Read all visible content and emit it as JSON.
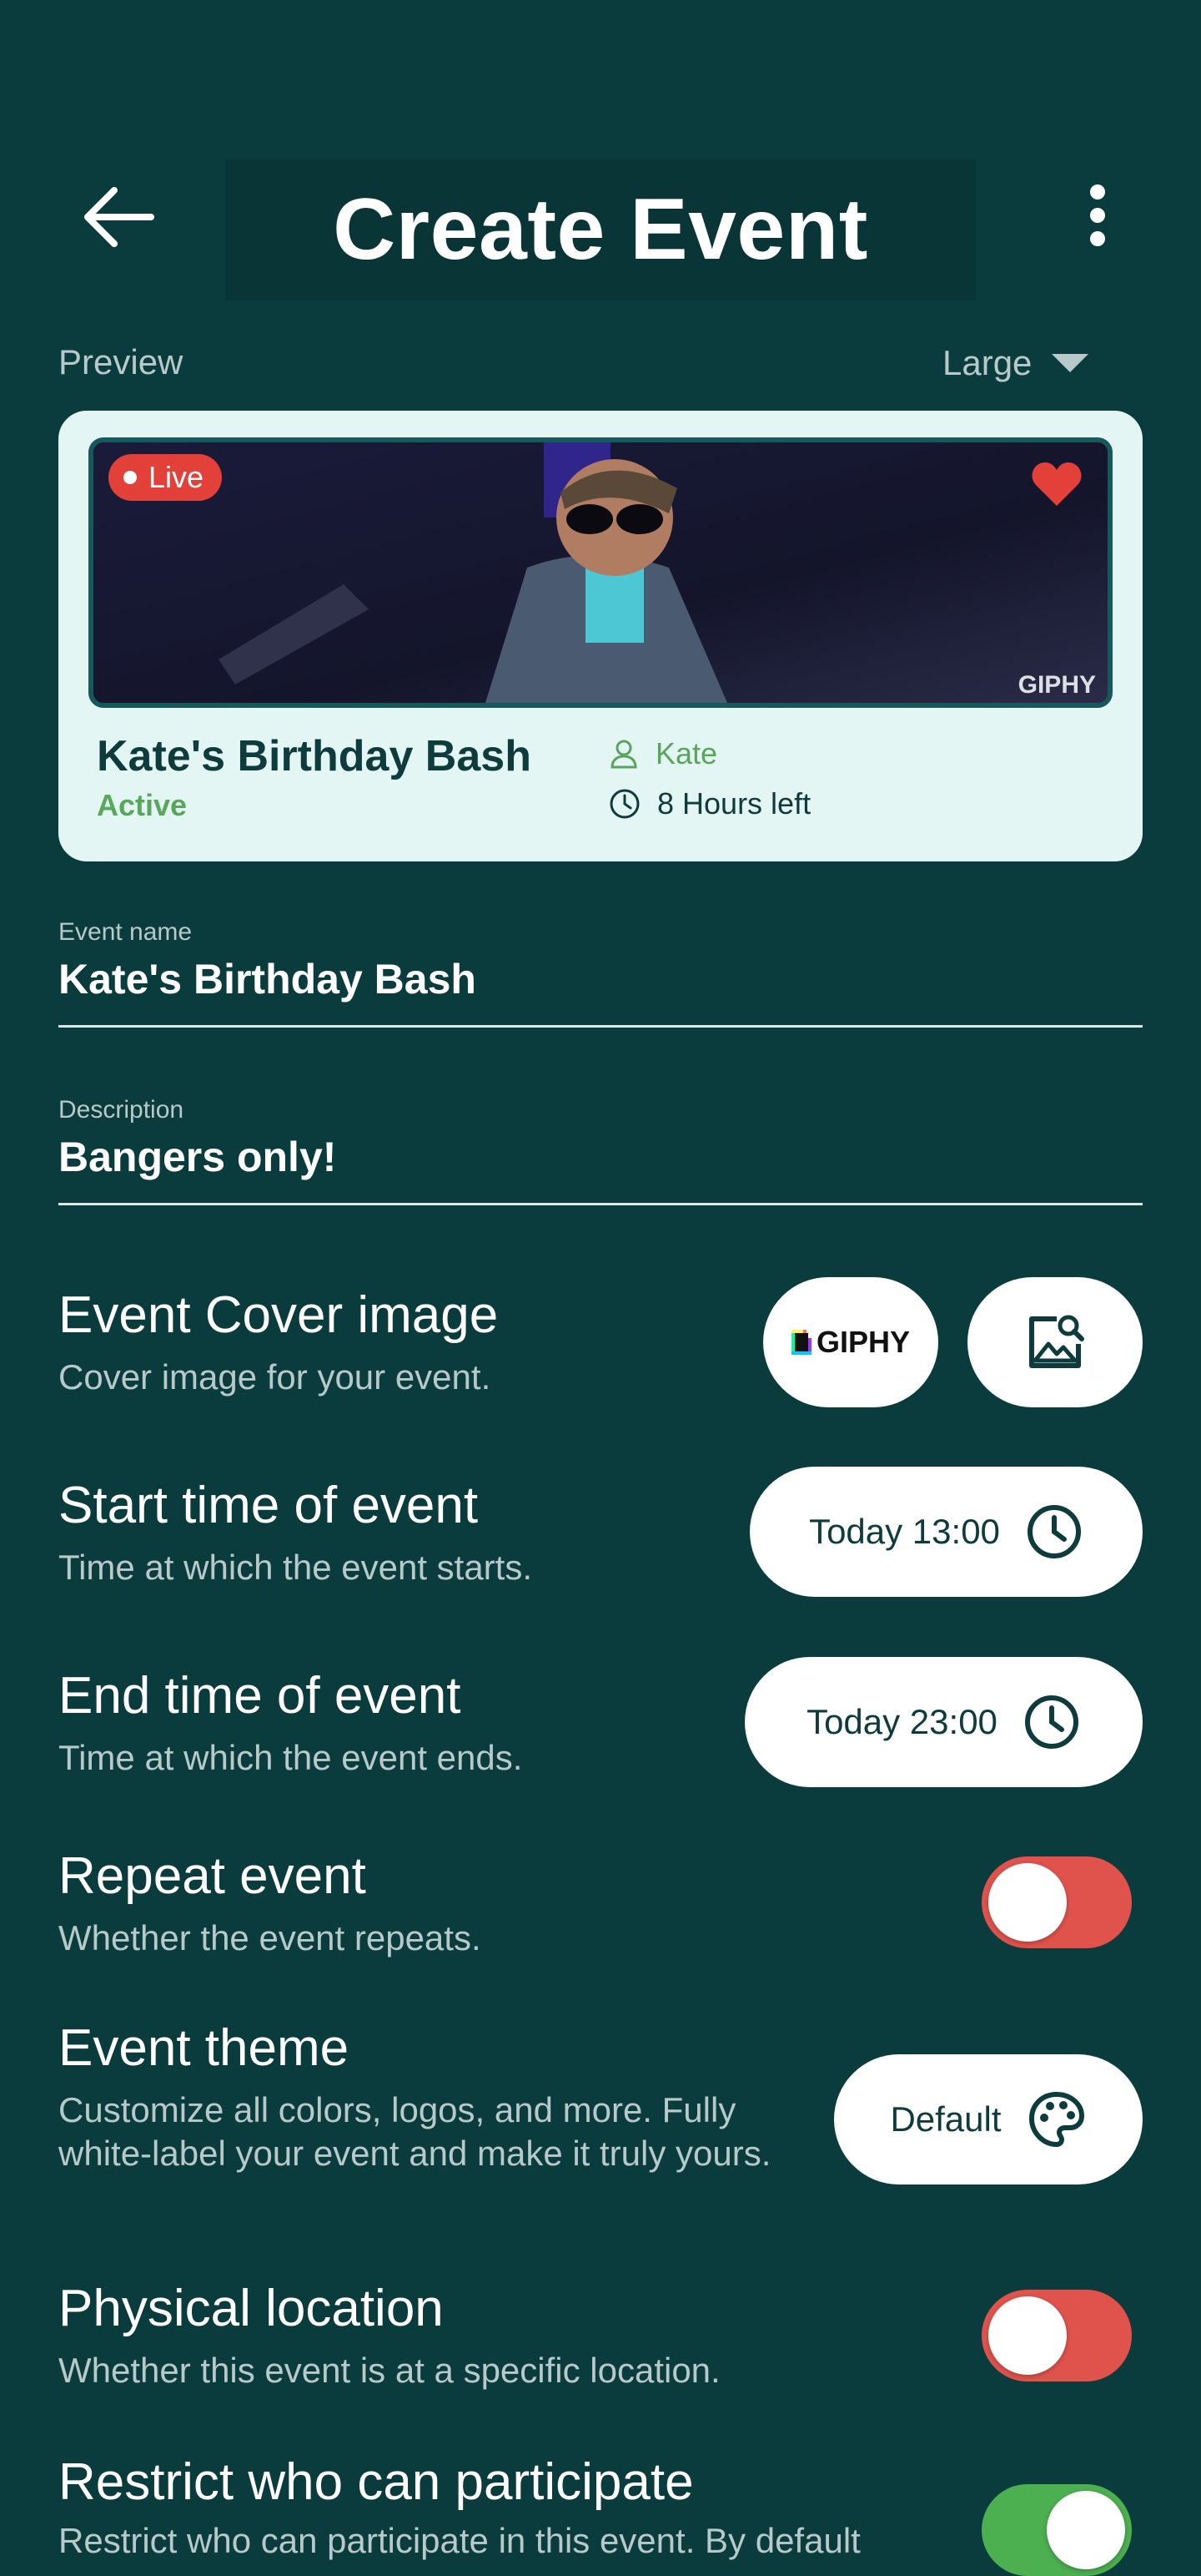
{
  "header": {
    "title": "Create Event"
  },
  "preview": {
    "label": "Preview",
    "size": "Large",
    "card": {
      "live_label": "Live",
      "event_title": "Kate's Birthday Bash",
      "status": "Active",
      "host": "Kate",
      "time_left": "8 Hours left",
      "image_watermark": "GIPHY"
    }
  },
  "fields": {
    "event_name": {
      "label": "Event name",
      "value": "Kate's Birthday Bash"
    },
    "description": {
      "label": "Description",
      "value": "Bangers only!"
    }
  },
  "settings": {
    "cover": {
      "title": "Event Cover image",
      "subtitle": "Cover image for your event.",
      "giphy_label": "GIPHY"
    },
    "start": {
      "title": "Start time of event",
      "subtitle": "Time at which the event starts.",
      "value": "Today 13:00"
    },
    "end": {
      "title": "End time of event",
      "subtitle": "Time at which the event ends.",
      "value": "Today 23:00"
    },
    "repeat": {
      "title": "Repeat event",
      "subtitle": "Whether the event repeats.",
      "enabled": false
    },
    "theme": {
      "title": "Event theme",
      "subtitle": "Customize all colors, logos, and more. Fully white-label your event and make it truly yours.",
      "value": "Default"
    },
    "location": {
      "title": "Physical location",
      "subtitle": "Whether this event is at a specific location.",
      "enabled": false
    },
    "restrict": {
      "title": "Restrict who can participate",
      "subtitle": "Restrict who can participate in this event. By default",
      "enabled": true
    }
  },
  "colors": {
    "background": "#0b3c3d",
    "card": "#e3f6f4",
    "toggle_off": "#e0534c",
    "toggle_on": "#4caf50",
    "live": "#e3403a",
    "active": "#57a85a"
  },
  "icons": [
    "back-arrow-icon",
    "more-vert-icon",
    "caret-down-icon",
    "heart-icon",
    "person-icon",
    "clock-icon",
    "image-search-icon",
    "palette-icon"
  ]
}
